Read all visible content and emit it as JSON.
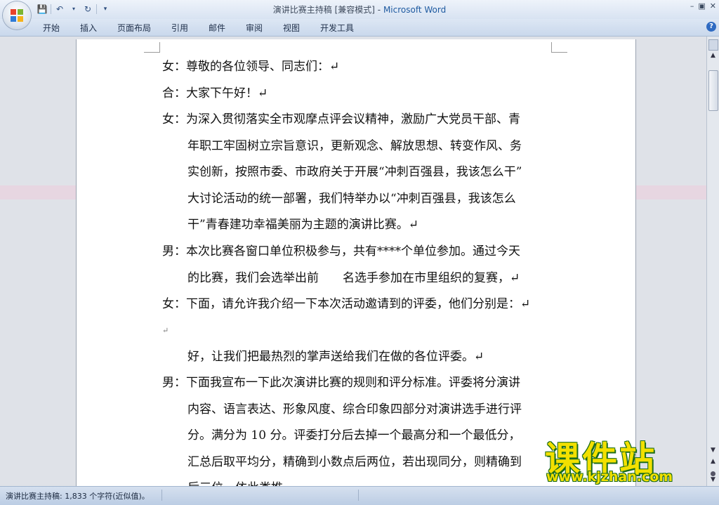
{
  "window": {
    "doc_name": "演讲比赛主持稿 [兼容模式]",
    "separator": " - ",
    "app_name": "Microsoft Word"
  },
  "quick_access": {
    "save_icon": "save-icon",
    "undo_icon": "undo-icon",
    "redo_icon": "redo-icon",
    "customize_icon": "dropdown-icon"
  },
  "ribbon": {
    "tabs": [
      "开始",
      "插入",
      "页面布局",
      "引用",
      "邮件",
      "审阅",
      "视图",
      "开发工具"
    ]
  },
  "document": {
    "paragraphs": [
      {
        "lines": [
          "女：尊敬的各位领导、同志们：↵"
        ]
      },
      {
        "lines": [
          "合：大家下午好！↵"
        ]
      },
      {
        "lines": [
          "女：为深入贯彻落实全市观摩点评会议精神，激励广大党员干部、青",
          "年职工牢固树立宗旨意识，更新观念、解放思想、转变作风、务",
          "实创新，按照市委、市政府关于开展“冲刺百强县，我该怎么干”",
          "大讨论活动的统一部署，我们特举办以“冲刺百强县，我该怎么",
          "干”青春建功幸福美丽为主题的演讲比赛。↵"
        ]
      },
      {
        "lines": [
          "男：本次比赛各窗口单位积极参与，共有****个单位参加。通过今天",
          "的比赛，我们会选举出前　　名选手参加在市里组织的复赛，↵"
        ]
      },
      {
        "lines": [
          "女：下面，请允许我介绍一下本次活动邀请到的评委，他们分别是：↵"
        ]
      },
      {
        "lines": [
          "↵"
        ]
      },
      {
        "lines": [
          "好，让我们把最热烈的掌声送给我们在做的各位评委。↵"
        ]
      },
      {
        "lines": [
          "男：下面我宣布一下此次演讲比赛的规则和评分标准。评委将分演讲",
          "内容、语言表达、形象风度、综合印象四部分对演讲选手进行评",
          "分。满分为 10 分。评委打分后去掉一个最高分和一个最低分，",
          "汇总后取平均分，精确到小数点后两位，若出现同分，则精确到",
          "后三位。依此类推。"
        ]
      }
    ]
  },
  "status_bar": {
    "word_count": "演讲比赛主持稿: 1,833 个字符(近似值)。"
  },
  "watermark": {
    "brand": "课件站",
    "url": "www.kjzhan.com"
  }
}
